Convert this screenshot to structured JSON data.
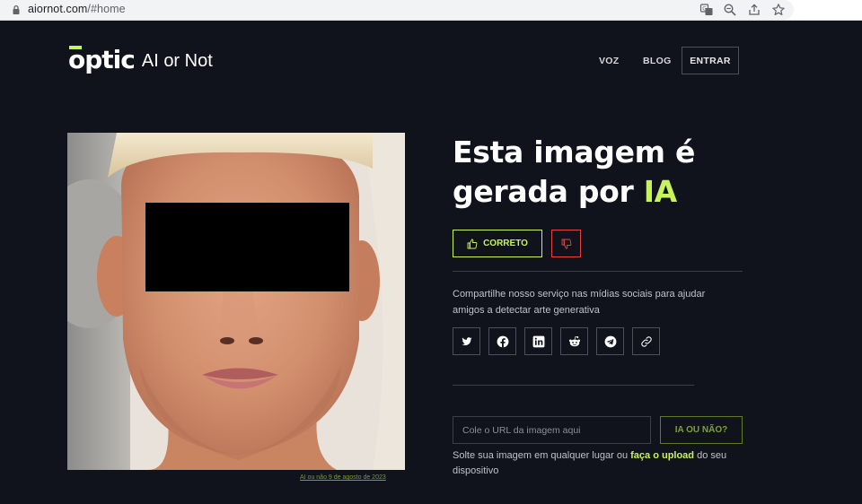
{
  "browser": {
    "url_domain": "aiornot.com",
    "url_path": "/#home"
  },
  "header": {
    "logo_brand": "optic",
    "logo_product": "AI or Not",
    "nav": {
      "voz": "VOZ",
      "blog": "BLOG",
      "entrar": "ENTRAR"
    }
  },
  "result": {
    "title_prefix": "Esta imagem é gerada por ",
    "title_accent": "IA",
    "correct_label": "CORRETO",
    "share_text": "Compartilhe nosso serviço nas mídias sociais para ajudar amigos a detectar arte generativa"
  },
  "image": {
    "caption": "AI ou não 9 de agosto de 2023"
  },
  "social": [
    "twitter-icon",
    "facebook-icon",
    "linkedin-icon",
    "reddit-icon",
    "telegram-icon",
    "link-icon"
  ],
  "check": {
    "placeholder": "Cole o URL da imagem aqui",
    "button_label": "IA OU NÃO?",
    "drop_before": "Solte sua imagem em qualquer lugar ou ",
    "drop_link": "faça o upload",
    "drop_after": " do seu dispositivo"
  },
  "colors": {
    "background": "#10131b",
    "accent": "#c7f35c",
    "danger": "#e0463e"
  }
}
